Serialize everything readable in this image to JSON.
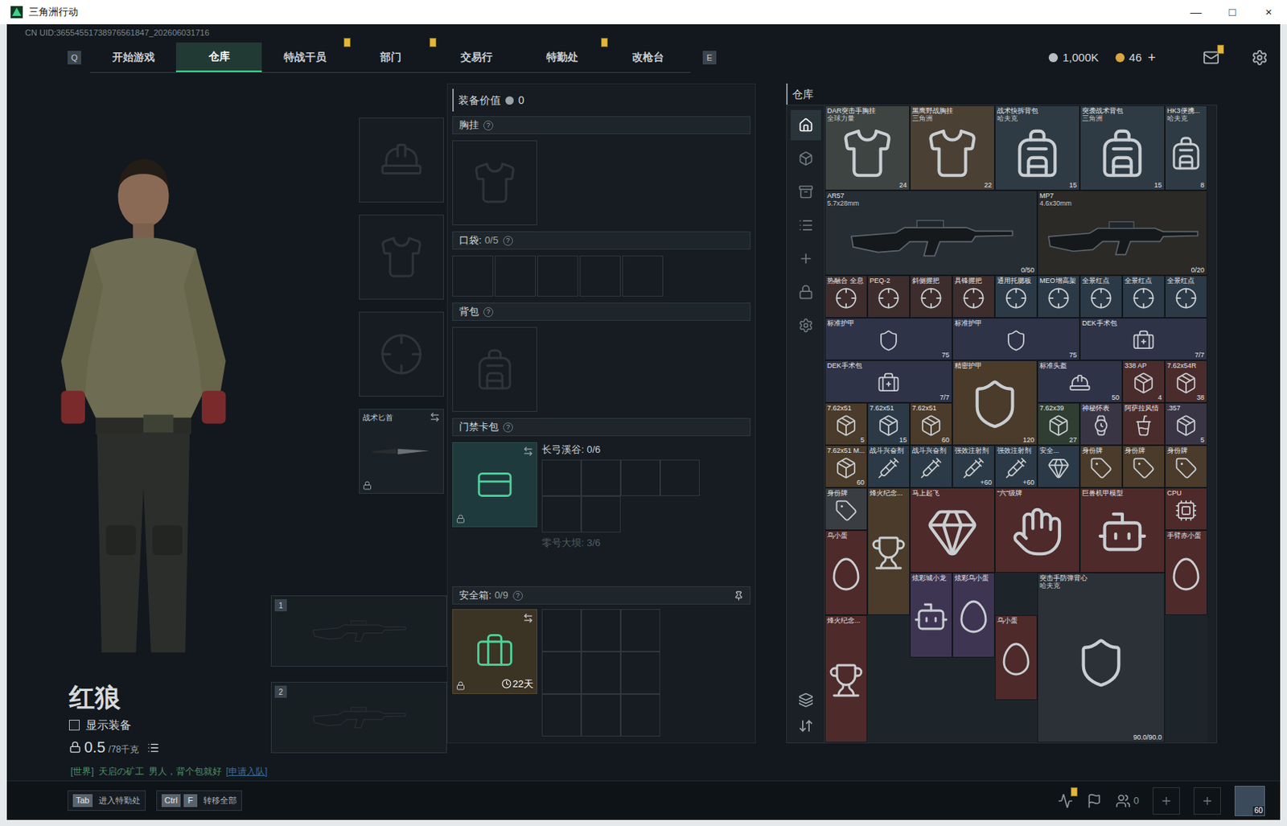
{
  "window": {
    "title": "三角洲行动",
    "controls": [
      "—",
      "□",
      "×"
    ]
  },
  "uid": "CN UID:36554551738976561847_202606031716",
  "nav": {
    "prev_key": "Q",
    "next_key": "E",
    "tabs": [
      {
        "label": "开始游戏",
        "selected": false,
        "badge": false
      },
      {
        "label": "仓库",
        "selected": true,
        "badge": false
      },
      {
        "label": "特战干员",
        "selected": false,
        "badge": true
      },
      {
        "label": "部门",
        "selected": false,
        "badge": true
      },
      {
        "label": "交易行",
        "selected": false,
        "badge": false
      },
      {
        "label": "特勤处",
        "selected": false,
        "badge": true
      },
      {
        "label": "改枪台",
        "selected": false,
        "badge": false
      }
    ]
  },
  "currencies": [
    {
      "value": "1,000K",
      "color": "#b8bec4"
    },
    {
      "value": "46",
      "color": "#d9a441"
    }
  ],
  "currency_add": "+",
  "mail": {
    "badge": true
  },
  "character": {
    "name": "红狼",
    "show_equipment": {
      "label": "显示装备",
      "checked": false
    },
    "weight": "0.5",
    "weight_max": "/78千克"
  },
  "chat": {
    "channel": "[世界]",
    "sender": "天启の矿工",
    "message": "男人，背个包就好",
    "action": "[申请入队]"
  },
  "gear_slots": [
    {
      "kind": "helmet"
    },
    {
      "kind": "armor"
    },
    {
      "kind": "pistol"
    },
    {
      "kind": "melee",
      "label": "战术匕首",
      "locked": true,
      "swappable": true
    }
  ],
  "weapon_slots": [
    {
      "number": "1"
    },
    {
      "number": "2"
    }
  ],
  "loadout": {
    "value_label": "装备价值",
    "value": "0",
    "chest_rig": {
      "label": "胸挂",
      "help": "?"
    },
    "pockets": {
      "label": "口袋:",
      "count": "0/5",
      "help": "?",
      "slots": [
        {
          "filled": false
        },
        {
          "filled": false
        },
        {
          "filled": false
        },
        {
          "filled": false
        },
        {
          "filled": false
        }
      ]
    },
    "backpack": {
      "label": "背包",
      "help": "?"
    },
    "keycard_case": {
      "label": "门禁卡包",
      "help": "?",
      "swappable": true,
      "locked": true,
      "maps": [
        {
          "label": "长弓溪谷: 0/6",
          "active": true
        },
        {
          "label": "零号大坝: 3/6",
          "active": false
        }
      ]
    },
    "safe_box": {
      "label": "安全箱:",
      "count": "0/9",
      "help": "?",
      "pinned": true,
      "time": "22天",
      "locked": true,
      "swappable": true,
      "slots": [
        {
          "filled": false
        },
        {
          "filled": false
        },
        {
          "filled": false
        },
        {
          "filled": false
        },
        {
          "filled": false
        },
        {
          "filled": false
        },
        {
          "filled": false
        },
        {
          "filled": false
        },
        {
          "filled": false
        }
      ]
    }
  },
  "warehouse": {
    "title": "仓库",
    "tabs": [
      {
        "selected": true
      },
      {
        "selected": false
      },
      {
        "selected": false
      },
      {
        "selected": false
      },
      {
        "selected": false
      },
      {
        "selected": false
      },
      {
        "selected": false
      }
    ],
    "items": [
      {
        "name": "DAR突击手胸挂",
        "sub": "全球力量",
        "count": "24",
        "kind": "vest",
        "color": "#3d4441"
      },
      {
        "name": "黑鹰野战胸挂",
        "sub": "三角洲",
        "count": "22",
        "kind": "vest",
        "color": "#4a4034"
      },
      {
        "name": "战术快拆背包",
        "sub": "哈夫克",
        "count": "15",
        "kind": "backpack",
        "color": "#2f3b44"
      },
      {
        "name": "突袭战术背包",
        "sub": "三角洲",
        "count": "15",
        "kind": "backpack",
        "color": "#2f3b44"
      },
      {
        "name": "HK3便携...",
        "sub": "哈夫克",
        "count": "8",
        "kind": "backpack",
        "color": "#2f3b44"
      },
      {
        "name": "AR57",
        "sub": "5.7x28mm",
        "count": "0/50",
        "kind": "rifle",
        "color": "#262d33"
      },
      {
        "name": "MP7",
        "sub": "4.6x30mm",
        "count": "0/20",
        "kind": "rifle",
        "color": "#2c2a26"
      },
      {
        "name": "热融合 全息",
        "count": "",
        "kind": "attachment",
        "color": "#3e2d2d"
      },
      {
        "name": "PEQ-2",
        "count": "",
        "kind": "attachment",
        "color": "#3e2d2d"
      },
      {
        "name": "斜侧握把",
        "count": "",
        "kind": "attachment",
        "color": "#3e2d2d"
      },
      {
        "name": "具锋握把",
        "count": "",
        "kind": "attachment",
        "color": "#3e2d2d"
      },
      {
        "name": "通用托腮板",
        "count": "",
        "kind": "attachment",
        "color": "#2c3a47"
      },
      {
        "name": "MEO增高架",
        "count": "",
        "kind": "attachment",
        "color": "#2c3a47"
      },
      {
        "name": "全景红点",
        "count": "",
        "kind": "attachment",
        "color": "#2c3a47"
      },
      {
        "name": "全景红点",
        "count": "",
        "kind": "attachment",
        "color": "#2c3a47"
      },
      {
        "name": "全景红点",
        "count": "",
        "kind": "attachment",
        "color": "#2c3a47"
      },
      {
        "name": "标准护甲",
        "count": "75",
        "kind": "armor",
        "color": "#2e3348"
      },
      {
        "name": "标准护甲",
        "count": "75",
        "kind": "armor",
        "color": "#2e3348"
      },
      {
        "name": "DEK手术包",
        "count": "7/7",
        "kind": "medkit",
        "color": "#2e3348"
      },
      {
        "name": "DEK手术包",
        "count": "7/7",
        "kind": "medkit",
        "color": "#2e3348"
      },
      {
        "name": "精密护甲",
        "count": "120",
        "kind": "armor",
        "color": "#4a3b2a"
      },
      {
        "name": "标准头盔",
        "count": "50",
        "kind": "helmet",
        "color": "#2e3348"
      },
      {
        "name": "338 AP",
        "count": "4",
        "kind": "ammo",
        "color": "#4a2c2c"
      },
      {
        "name": "7.62x54R",
        "count": "38",
        "kind": "ammo",
        "color": "#4a2c2c"
      },
      {
        "name": "7.62x51",
        "count": "5",
        "kind": "ammo",
        "color": "#4a3b2a"
      },
      {
        "name": "7.62x51",
        "count": "15",
        "kind": "ammo",
        "color": "#2c3a47"
      },
      {
        "name": "7.62x51",
        "count": "60",
        "kind": "ammo",
        "color": "#4a3b2a"
      },
      {
        "name": "7.62x39",
        "count": "27",
        "kind": "ammo",
        "color": "#2f3d33"
      },
      {
        "name": "神秘怀表",
        "count": "",
        "kind": "watch",
        "color": "#3a3545"
      },
      {
        "name": "阿萨拉风情",
        "count": "",
        "kind": "drink",
        "color": "#4a2c2c"
      },
      {
        "name": ".357",
        "count": "5",
        "kind": "ammo",
        "color": "#3a3545"
      },
      {
        "name": "7.62x51 M...",
        "count": "60",
        "kind": "ammo",
        "color": "#4a3b2a"
      },
      {
        "name": "战斗兴奋剂",
        "count": "",
        "kind": "injector",
        "color": "#2c3a47"
      },
      {
        "name": "战斗兴奋剂",
        "count": "",
        "kind": "injector",
        "color": "#2c3a47"
      },
      {
        "name": "强效注射剂",
        "count": "+60",
        "kind": "injector",
        "color": "#2c3a47"
      },
      {
        "name": "强效注射剂",
        "count": "+60",
        "kind": "injector",
        "color": "#2c3a47"
      },
      {
        "name": "安全...",
        "count": "",
        "kind": "gem",
        "color": "#2c3a47"
      },
      {
        "name": "身份牌",
        "count": "",
        "kind": "tag",
        "color": "#4a3b2a"
      },
      {
        "name": "身份牌",
        "count": "",
        "kind": "tag",
        "color": "#4a3b2a"
      },
      {
        "name": "身份牌",
        "count": "",
        "kind": "tag",
        "color": "#4a3b2a"
      },
      {
        "name": "身份牌",
        "count": "",
        "kind": "tag",
        "color": "#3a3d42"
      },
      {
        "name": "烽火纪念...",
        "count": "",
        "kind": "trophy",
        "color": "#4a3b2a"
      },
      {
        "name": "马上起飞",
        "count": "",
        "kind": "gem",
        "color": "#4e2a2a"
      },
      {
        "name": "“六”级牌",
        "count": "",
        "kind": "hand",
        "color": "#4e2a2a"
      },
      {
        "name": "巨兽机甲模型",
        "count": "",
        "kind": "figure",
        "color": "#4e2a2a"
      },
      {
        "name": "CPU",
        "count": "",
        "kind": "cpu",
        "color": "#4e2a2a"
      },
      {
        "name": "乌小蛋",
        "count": "",
        "kind": "egg",
        "color": "#4e2a2a"
      },
      {
        "name": "手臂赤小蛋",
        "count": "",
        "kind": "egg",
        "color": "#4e2a2a"
      },
      {
        "name": "炫彩城小龙",
        "count": "",
        "kind": "figure",
        "color": "#3e3553"
      },
      {
        "name": "炫彩乌小蛋",
        "count": "",
        "kind": "egg",
        "color": "#3e3553"
      },
      {
        "name": "突击手防弹背心",
        "sub": "哈夫克",
        "count": "90.0/90.0",
        "kind": "armor",
        "color": "#2b3137"
      },
      {
        "name": "烽火纪念...",
        "count": "",
        "kind": "trophy",
        "color": "#4e2a2a"
      },
      {
        "name": "乌小蛋",
        "count": "",
        "kind": "egg",
        "color": "#4e2a2a"
      }
    ]
  },
  "bottom_bar": {
    "hints": [
      {
        "keys": [
          "Tab"
        ],
        "label": "进入特勤处"
      },
      {
        "keys": [
          "Ctrl",
          "F"
        ],
        "label": "转移全部"
      }
    ],
    "stats_badge": true,
    "team_count": "0",
    "avatar_level": "60"
  }
}
